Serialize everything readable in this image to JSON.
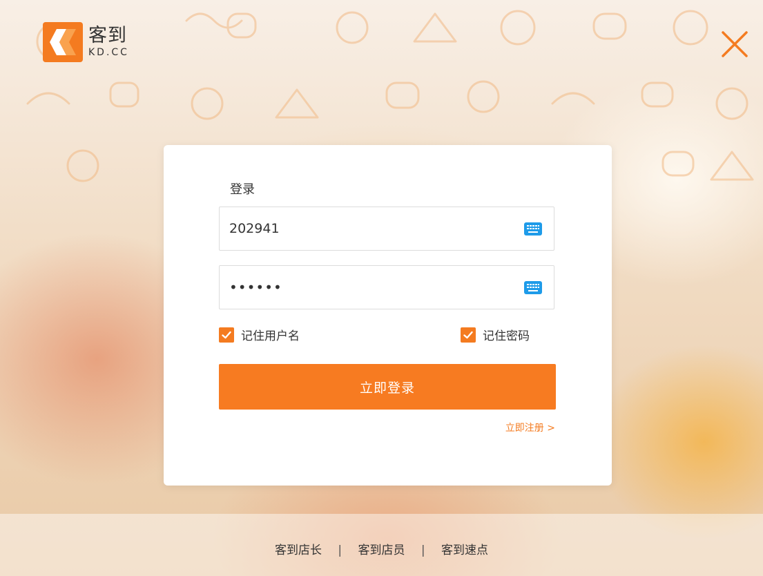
{
  "brand": {
    "name": "客到",
    "domain": "KD.CC",
    "color": "#f47b20"
  },
  "login": {
    "title": "登录",
    "username": {
      "value": "202941",
      "icon": "keyboard-icon"
    },
    "password": {
      "value": "••••••",
      "icon": "keyboard-icon"
    },
    "remember_username": {
      "label": "记住用户名",
      "checked": true
    },
    "remember_password": {
      "label": "记住密码",
      "checked": true
    },
    "submit_label": "立即登录",
    "register_label": "立即注册 >"
  },
  "footer": {
    "links": [
      "客到店长",
      "客到店员",
      "客到速点"
    ],
    "separator": "|"
  },
  "icons": {
    "close": "close-icon",
    "check": "checkmark-icon"
  },
  "colors": {
    "accent": "#f77b21",
    "keyboard_icon": "#1e9be9"
  }
}
